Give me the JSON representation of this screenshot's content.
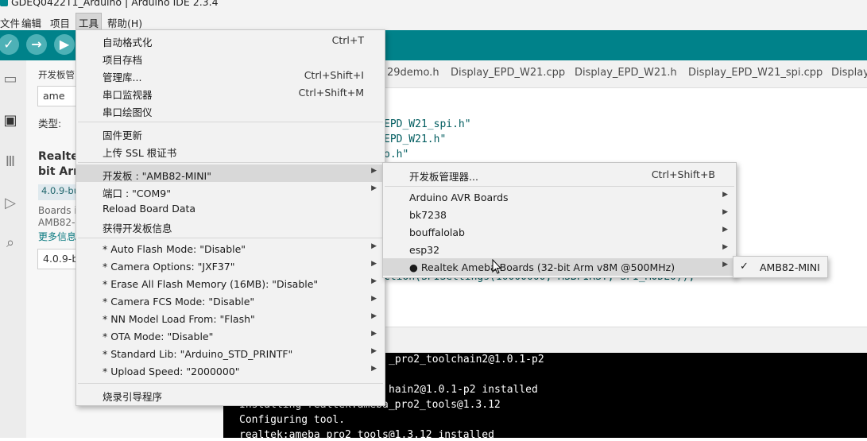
{
  "window": {
    "title": "GDEQ0422T1_Arduino | Arduino IDE 2.3.4"
  },
  "menubar": {
    "file": "文件",
    "edit": "编辑",
    "sketch": "项目",
    "tools": "工具",
    "help": "帮助(H)"
  },
  "toolbar": {
    "verify_icon": "check-icon",
    "upload_icon": "arrow-right-icon",
    "debug_icon": "debug-icon"
  },
  "sidebar_panel": {
    "heading": "开发板管",
    "search_value": "ame",
    "type_label": "类型:",
    "board_title_1": "Realte",
    "board_title_2": "bit Arr",
    "version_badge": "4.0.9-bu",
    "desc_1": "Boards i",
    "desc_2": "AMB82-",
    "more_info": "更多信息",
    "version_select": "4.0.9-b"
  },
  "editor": {
    "tabs": [
      "29demo.h",
      "Display_EPD_W21.cpp",
      "Display_EPD_W21.h",
      "Display_EPD_W21_spi.cpp",
      "Display_"
    ],
    "lines": [
      "EPD_W21_spi.h\"",
      "EPD_W21.h\"",
      "o.h\"",
      "ction(SPISettings(10000000, MSBFIRST, SPI_MODE0));"
    ]
  },
  "console": {
    "lines": [
      "_pro2_toolchain2@1.0.1-p2",
      "",
      "hain2@1.0.1-p2 installed",
      "Installing realtek:ameba_pro2_tools@1.3.12",
      "Configuring tool.",
      "realtek:ameba_pro2_tools@1.3.12 installed"
    ]
  },
  "tools_menu": {
    "auto_format": "自动格式化",
    "auto_format_sc": "Ctrl+T",
    "archive": "项目存档",
    "manage_libs": "管理库...",
    "manage_libs_sc": "Ctrl+Shift+I",
    "serial_monitor": "串口监视器",
    "serial_monitor_sc": "Ctrl+Shift+M",
    "serial_plotter": "串口绘图仪",
    "firmware_updater": "固件更新",
    "upload_ssl": "上传 SSL 根证书",
    "board": "开发板 : \"AMB82-MINI\"",
    "port": "端口 : \"COM9\"",
    "reload": "Reload Board Data",
    "board_info": "获得开发板信息",
    "opt_auto_flash": "* Auto Flash Mode: \"Disable\"",
    "opt_camera": "* Camera Options: \"JXF37\"",
    "opt_erase": "* Erase All Flash Memory (16MB): \"Disable\"",
    "opt_fcs": "* Camera FCS Mode: \"Disable\"",
    "opt_nn": "* NN Model Load From: \"Flash\"",
    "opt_ota": "* OTA Mode: \"Disable\"",
    "opt_stdlib": "* Standard Lib: \"Arduino_STD_PRINTF\"",
    "opt_speed": "* Upload Speed: \"2000000\"",
    "burn_bootloader": "烧录引导程序"
  },
  "board_submenu": {
    "manager": "开发板管理器...",
    "manager_sc": "Ctrl+Shift+B",
    "avr": "Arduino AVR Boards",
    "bk7238": "bk7238",
    "bouffalolab": "bouffalolab",
    "esp32": "esp32",
    "realtek": "● Realtek Ameba Boards (32-bit Arm v8M @500MHz)"
  },
  "realtek_submenu": {
    "check": "✓",
    "amb82": "AMB82-MINI"
  },
  "colors": {
    "toolbar": "#00828a",
    "button": "#4db1b6",
    "highlight": "#d8d8d8"
  }
}
